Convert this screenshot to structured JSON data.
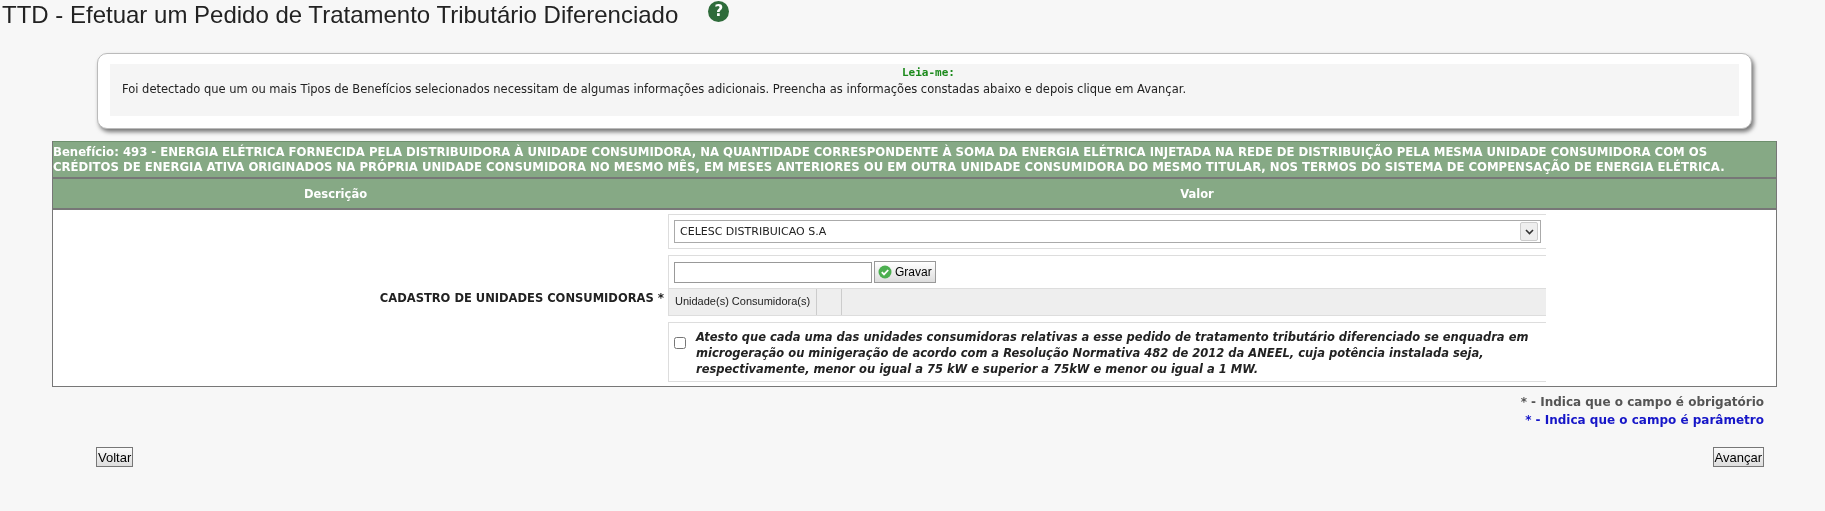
{
  "page": {
    "title": "TTD - Efetuar um Pedido de Tratamento Tributário Diferenciado",
    "help_icon": "?"
  },
  "readme": {
    "heading": "Leia-me:",
    "text": "Foi detectado que um ou mais Tipos de Benefícios selecionados necessitam de algumas informações adicionais. Preencha as informações constadas abaixo e depois clique em Avançar."
  },
  "benefit": {
    "text": "Benefício: 493 - ENERGIA ELÉTRICA FORNECIDA PELA DISTRIBUIDORA À UNIDADE CONSUMIDORA, NA QUANTIDADE CORRESPONDENTE À SOMA DA ENERGIA ELÉTRICA INJETADA NA REDE DE DISTRIBUIÇÃO PELA MESMA UNIDADE CONSUMIDORA COM OS CRÉDITOS DE ENERGIA ATIVA ORIGINADOS NA PRÓPRIA UNIDADE CONSUMIDORA NO MESMO MÊS, EM MESES ANTERIORES OU EM OUTRA UNIDADE CONSUMIDORA DO MESMO TITULAR, NOS TERMOS DO SISTEMA DE COMPENSAÇÃO DE ENERGIA ELÉTRICA."
  },
  "table": {
    "columns": [
      "Descrição",
      "Valor"
    ],
    "field": {
      "label": "CADASTRO DE UNIDADES CONSUMIDORAS",
      "required_mark": "*",
      "distributor_select": {
        "value": "CELESC DISTRIBUICAO S.A"
      },
      "save_button": "Gravar",
      "grid_columns": [
        "Unidade(s) Consumidora(s)"
      ],
      "attest": {
        "checked": false,
        "text": "Atesto que cada uma das unidades consumidoras relativas a esse pedido de tratamento tributário diferenciado se enquadra em microgeração ou minigeração de acordo com a Resolução Normativa 482 de 2012 da ANEEL, cuja potência instalada seja, respectivamente, menor ou igual a 75 kW e superior a 75kW e menor ou igual a 1 MW."
      }
    }
  },
  "legend": [
    {
      "kind": "required",
      "mark": "*",
      "text": "- Indica que o campo é obrigatório"
    },
    {
      "kind": "parameter",
      "mark": "*",
      "text": "- Indica que o campo é parâmetro"
    }
  ],
  "buttons": {
    "back": "Voltar",
    "next": "Avançar"
  }
}
